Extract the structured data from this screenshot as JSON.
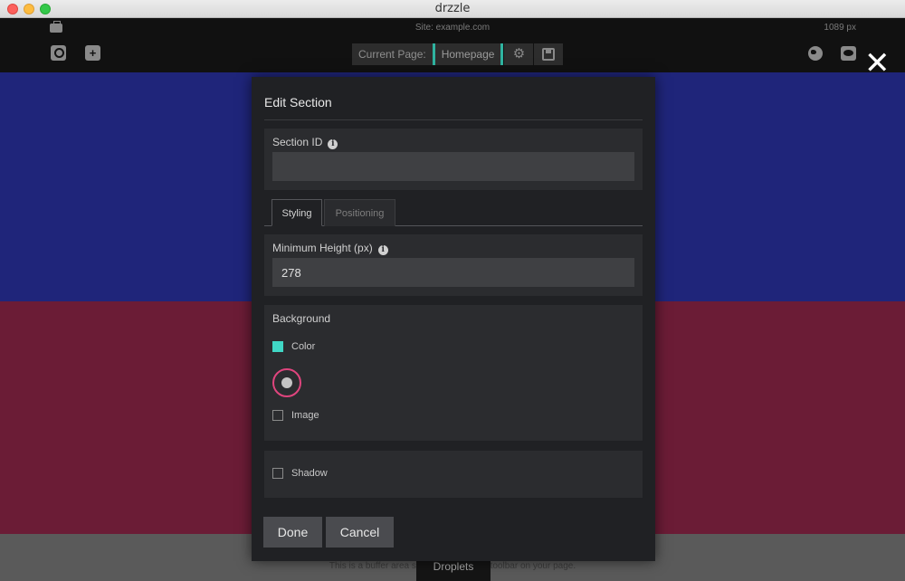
{
  "window": {
    "title": "drzzle"
  },
  "topbar": {
    "site": "Site: example.com",
    "width_label": "1089 px",
    "current_page_label": "Current Page:",
    "current_page_value": "Homepage",
    "close_glyph": "✕"
  },
  "canvas": {
    "section_colors": [
      "#1f257a",
      "#6b1c36",
      "#5a5a5a"
    ],
    "buffer_text": "This is a buffer area so you can see the toolbar on your page.",
    "droplets_label": "Droplets"
  },
  "modal": {
    "title": "Edit Section",
    "section_id": {
      "label": "Section ID",
      "info": "i",
      "value": ""
    },
    "tabs": [
      {
        "label": "Styling",
        "active": true
      },
      {
        "label": "Positioning",
        "active": false
      }
    ],
    "min_height": {
      "label": "Minimum Height (px)",
      "info": "i",
      "value": "278"
    },
    "background": {
      "label": "Background",
      "color_label": "Color",
      "color_checked": true,
      "image_label": "Image",
      "image_checked": false
    },
    "shadow": {
      "label": "Shadow",
      "checked": false
    },
    "buttons": {
      "done": "Done",
      "cancel": "Cancel"
    }
  },
  "colors": {
    "accent": "#40d7c5",
    "palette_ring": "#e0457e"
  }
}
